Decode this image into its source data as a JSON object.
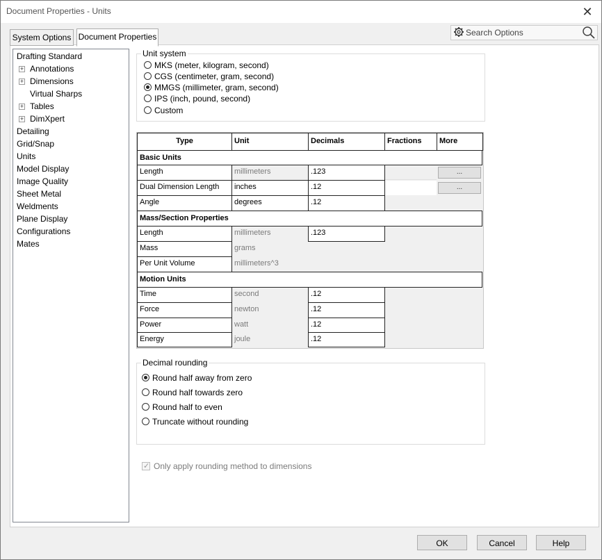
{
  "window": {
    "title": "Document Properties - Units",
    "close_glyph": "✕"
  },
  "tabs": [
    {
      "label": "System Options"
    },
    {
      "label": "Document Properties"
    }
  ],
  "search": {
    "placeholder": "Search Options"
  },
  "tree": [
    {
      "label": "Drafting Standard"
    },
    {
      "label": "Annotations",
      "expander": "+"
    },
    {
      "label": "Dimensions",
      "expander": "+"
    },
    {
      "label": "Virtual Sharps"
    },
    {
      "label": "Tables",
      "expander": "+"
    },
    {
      "label": "DimXpert",
      "expander": "+"
    },
    {
      "label": "Detailing"
    },
    {
      "label": "Grid/Snap"
    },
    {
      "label": "Units",
      "selected": true
    },
    {
      "label": "Model Display"
    },
    {
      "label": "Image Quality"
    },
    {
      "label": "Sheet Metal"
    },
    {
      "label": "Weldments"
    },
    {
      "label": "Plane Display"
    },
    {
      "label": "Configurations"
    },
    {
      "label": "Mates"
    }
  ],
  "unit_system": {
    "legend": "Unit system",
    "options": [
      {
        "label": "MKS  (meter, kilogram, second)",
        "checked": false
      },
      {
        "label": "CGS  (centimeter, gram, second)",
        "checked": false
      },
      {
        "label": "MMGS (millimeter, gram, second)",
        "checked": true
      },
      {
        "label": "IPS  (inch, pound, second)",
        "checked": false
      },
      {
        "label": "Custom",
        "checked": false
      }
    ]
  },
  "table": {
    "headers": [
      "Type",
      "Unit",
      "Decimals",
      "Fractions",
      "More"
    ],
    "sections": {
      "basic": "Basic Units",
      "mass": "Mass/Section Properties",
      "motion": "Motion Units"
    },
    "rows": {
      "length": {
        "type": "Length",
        "unit": "millimeters",
        "decimals": ".123",
        "more": "..."
      },
      "dual": {
        "type": "Dual Dimension Length",
        "unit": "inches",
        "decimals": ".12",
        "more": "..."
      },
      "angle": {
        "type": "Angle",
        "unit": "degrees",
        "decimals": ".12"
      },
      "mlength": {
        "type": "Length",
        "unit": "millimeters",
        "decimals": ".123"
      },
      "mass": {
        "type": "Mass",
        "unit": "grams",
        "decimals": ""
      },
      "puv": {
        "type": "Per Unit Volume",
        "unit": "millimeters^3",
        "decimals": ""
      },
      "time": {
        "type": "Time",
        "unit": "second",
        "decimals": ".12"
      },
      "force": {
        "type": "Force",
        "unit": "newton",
        "decimals": ".12"
      },
      "power": {
        "type": "Power",
        "unit": "watt",
        "decimals": ".12"
      },
      "energy": {
        "type": "Energy",
        "unit": "joule",
        "decimals": ".12"
      }
    }
  },
  "rounding": {
    "legend": "Decimal rounding",
    "options": [
      {
        "label": "Round half away from zero",
        "checked": true
      },
      {
        "label": "Round half towards zero",
        "checked": false
      },
      {
        "label": "Round half to even",
        "checked": false
      },
      {
        "label": "Truncate without rounding",
        "checked": false
      }
    ]
  },
  "only_apply": {
    "label": "Only apply rounding method to dimensions",
    "checked": true,
    "disabled": true,
    "tick": "✓"
  },
  "buttons": {
    "ok": "OK",
    "cancel": "Cancel",
    "help": "Help"
  }
}
